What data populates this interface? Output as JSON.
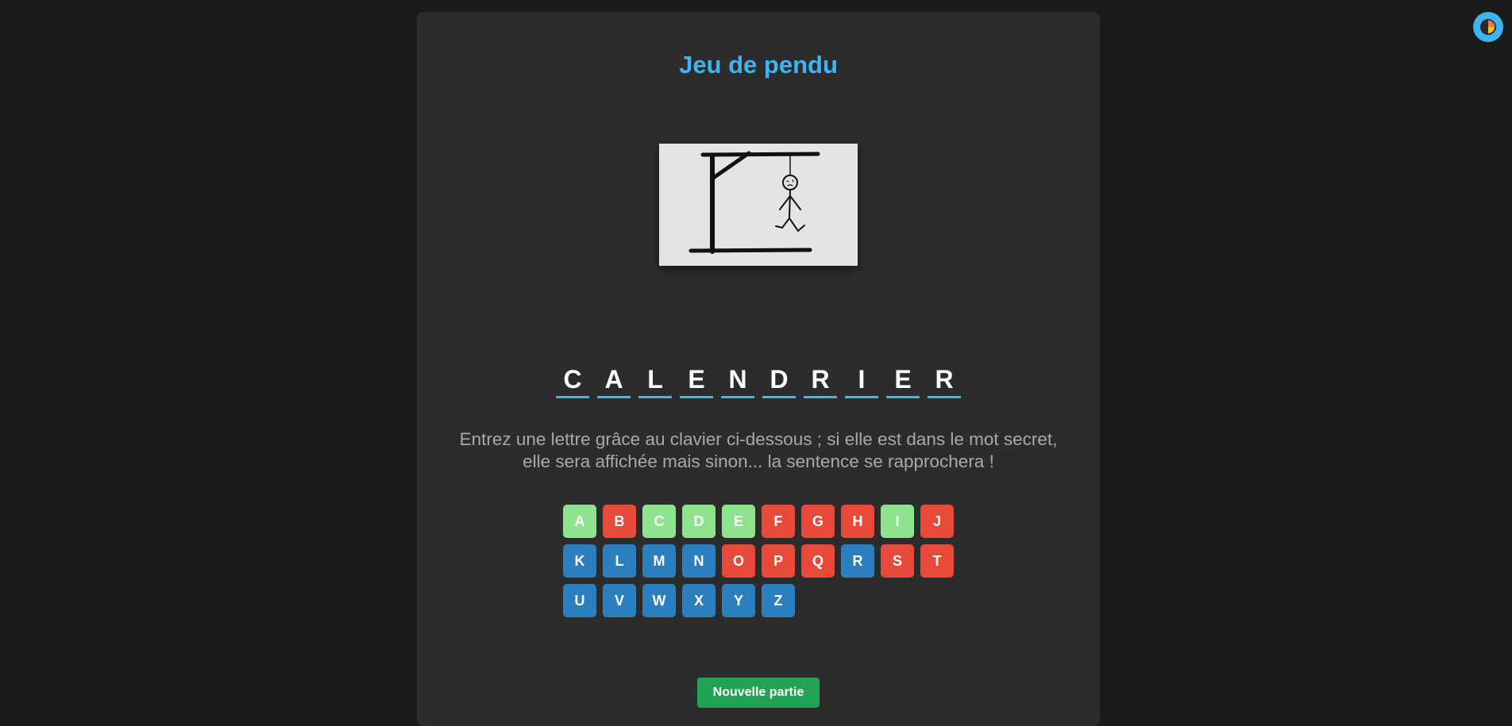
{
  "theme_toggle": {
    "icon": "half-circle-contrast-icon"
  },
  "game": {
    "title": "Jeu de pendu",
    "word_letters": [
      "C",
      "A",
      "L",
      "E",
      "N",
      "D",
      "R",
      "I",
      "E",
      "R"
    ],
    "instructions": "Entrez une lettre grâce au clavier ci-dessous ; si elle est dans le mot secret, elle sera affichée mais sinon... la sentence se rapprochera !",
    "keyboard": [
      {
        "letter": "A",
        "state": "correct"
      },
      {
        "letter": "B",
        "state": "wrong"
      },
      {
        "letter": "C",
        "state": "correct"
      },
      {
        "letter": "D",
        "state": "correct"
      },
      {
        "letter": "E",
        "state": "correct"
      },
      {
        "letter": "F",
        "state": "wrong"
      },
      {
        "letter": "G",
        "state": "wrong"
      },
      {
        "letter": "H",
        "state": "wrong"
      },
      {
        "letter": "I",
        "state": "correct"
      },
      {
        "letter": "J",
        "state": "wrong"
      },
      {
        "letter": "K",
        "state": "available"
      },
      {
        "letter": "L",
        "state": "available"
      },
      {
        "letter": "M",
        "state": "available"
      },
      {
        "letter": "N",
        "state": "available"
      },
      {
        "letter": "O",
        "state": "wrong"
      },
      {
        "letter": "P",
        "state": "wrong"
      },
      {
        "letter": "Q",
        "state": "wrong"
      },
      {
        "letter": "R",
        "state": "available"
      },
      {
        "letter": "S",
        "state": "wrong"
      },
      {
        "letter": "T",
        "state": "wrong"
      },
      {
        "letter": "U",
        "state": "available"
      },
      {
        "letter": "V",
        "state": "available"
      },
      {
        "letter": "W",
        "state": "available"
      },
      {
        "letter": "X",
        "state": "available"
      },
      {
        "letter": "Y",
        "state": "available"
      },
      {
        "letter": "Z",
        "state": "available"
      }
    ],
    "new_game_label": "Nouvelle partie"
  },
  "colors": {
    "accent": "#40b5f0",
    "correct": "#8fe38f",
    "wrong": "#e7493b",
    "available": "#2b7fbf",
    "new_game": "#22a255"
  }
}
